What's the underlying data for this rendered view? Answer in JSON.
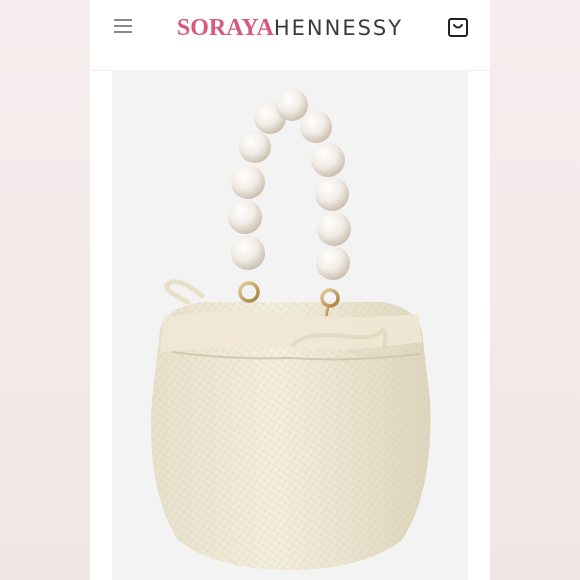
{
  "header": {
    "brand_primary": "SORAYA",
    "brand_secondary": "HENNESSY",
    "menu_icon": "hamburger-menu-icon",
    "cart_icon": "shopping-bag-icon"
  },
  "product": {
    "image_icon": "pearl-handle-bucket-bag"
  },
  "colors": {
    "brand_accent": "#d9587c",
    "brand_text": "#3a3a3a",
    "background": "#f3ecec"
  }
}
